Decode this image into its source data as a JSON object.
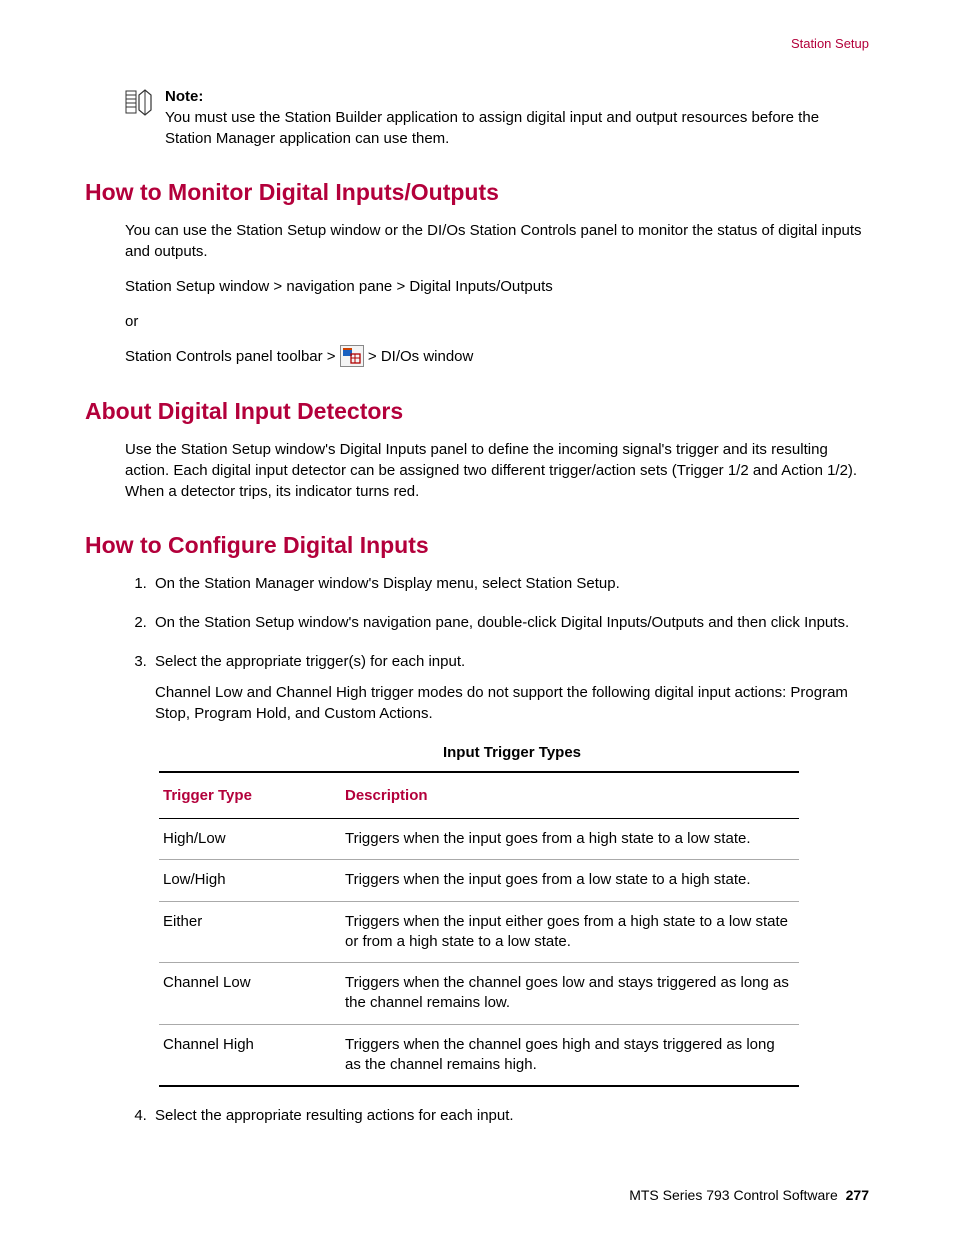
{
  "header": {
    "link": "Station Setup"
  },
  "note": {
    "label": "Note:",
    "body": "You must use the Station Builder application to assign digital input and output resources before the Station Manager application can use them."
  },
  "section1": {
    "title": "How to Monitor Digital Inputs/Outputs",
    "p1": "You can use the Station Setup window or the DI/Os Station Controls panel to monitor the status of digital inputs and outputs.",
    "p2": "Station Setup window > navigation pane > Digital Inputs/Outputs",
    "p3": "or",
    "p4a": "Station Controls panel toolbar > ",
    "p4b": " > DI/Os window"
  },
  "section2": {
    "title": "About Digital Input Detectors",
    "p1": "Use the Station Setup window's Digital Inputs panel to define the incoming signal's trigger and its resulting action. Each digital input detector can be assigned two different trigger/action sets (Trigger 1/2 and Action 1/2). When a detector trips, its indicator turns red."
  },
  "section3": {
    "title": "How to Configure Digital Inputs",
    "steps": [
      {
        "text": "On the Station Manager window's Display menu, select Station Setup."
      },
      {
        "text": "On the Station Setup window's navigation pane, double-click Digital Inputs/Outputs and then click Inputs."
      },
      {
        "text": "Select the appropriate trigger(s) for each input.",
        "extra": "Channel Low and Channel High trigger modes do not support the following digital input actions: Program Stop, Program Hold, and Custom Actions."
      },
      {
        "text": "Select the appropriate resulting actions for each input."
      }
    ]
  },
  "table": {
    "caption": "Input Trigger Types",
    "headers": {
      "c1": "Trigger Type",
      "c2": "Description"
    },
    "rows": [
      {
        "type": "High/Low",
        "desc": "Triggers when the input goes from a high state to a low state."
      },
      {
        "type": "Low/High",
        "desc": "Triggers when the input goes from a low state to a high state."
      },
      {
        "type": "Either",
        "desc": "Triggers when the input either goes from a high state to a low state or from a high state to a low state."
      },
      {
        "type": "Channel Low",
        "desc": "Triggers when the channel goes low and stays triggered as long as the channel remains low."
      },
      {
        "type": "Channel High",
        "desc": "Triggers when the channel goes high and stays triggered as long as the channel remains high."
      }
    ]
  },
  "footer": {
    "product": "MTS Series 793 Control Software",
    "page": "277"
  }
}
